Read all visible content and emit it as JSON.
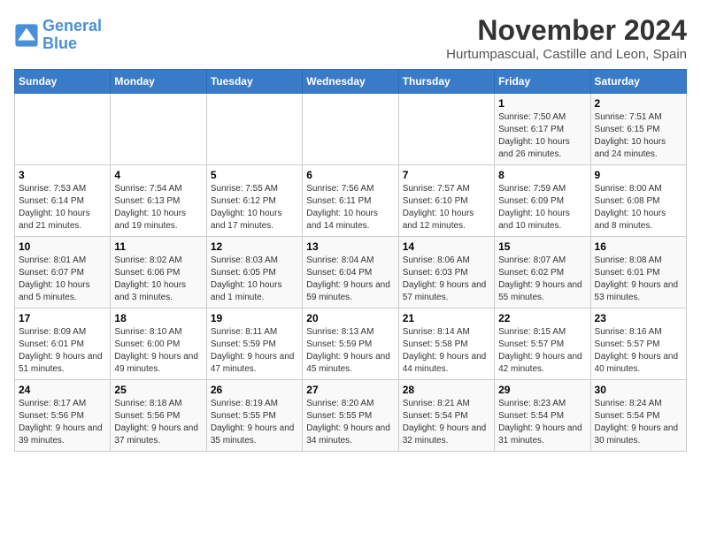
{
  "logo": {
    "line1": "General",
    "line2": "Blue"
  },
  "title": "November 2024",
  "location": "Hurtumpascual, Castille and Leon, Spain",
  "days_header": [
    "Sunday",
    "Monday",
    "Tuesday",
    "Wednesday",
    "Thursday",
    "Friday",
    "Saturday"
  ],
  "weeks": [
    [
      {
        "day": "",
        "info": ""
      },
      {
        "day": "",
        "info": ""
      },
      {
        "day": "",
        "info": ""
      },
      {
        "day": "",
        "info": ""
      },
      {
        "day": "",
        "info": ""
      },
      {
        "day": "1",
        "info": "Sunrise: 7:50 AM\nSunset: 6:17 PM\nDaylight: 10 hours and 26 minutes."
      },
      {
        "day": "2",
        "info": "Sunrise: 7:51 AM\nSunset: 6:15 PM\nDaylight: 10 hours and 24 minutes."
      }
    ],
    [
      {
        "day": "3",
        "info": "Sunrise: 7:53 AM\nSunset: 6:14 PM\nDaylight: 10 hours and 21 minutes."
      },
      {
        "day": "4",
        "info": "Sunrise: 7:54 AM\nSunset: 6:13 PM\nDaylight: 10 hours and 19 minutes."
      },
      {
        "day": "5",
        "info": "Sunrise: 7:55 AM\nSunset: 6:12 PM\nDaylight: 10 hours and 17 minutes."
      },
      {
        "day": "6",
        "info": "Sunrise: 7:56 AM\nSunset: 6:11 PM\nDaylight: 10 hours and 14 minutes."
      },
      {
        "day": "7",
        "info": "Sunrise: 7:57 AM\nSunset: 6:10 PM\nDaylight: 10 hours and 12 minutes."
      },
      {
        "day": "8",
        "info": "Sunrise: 7:59 AM\nSunset: 6:09 PM\nDaylight: 10 hours and 10 minutes."
      },
      {
        "day": "9",
        "info": "Sunrise: 8:00 AM\nSunset: 6:08 PM\nDaylight: 10 hours and 8 minutes."
      }
    ],
    [
      {
        "day": "10",
        "info": "Sunrise: 8:01 AM\nSunset: 6:07 PM\nDaylight: 10 hours and 5 minutes."
      },
      {
        "day": "11",
        "info": "Sunrise: 8:02 AM\nSunset: 6:06 PM\nDaylight: 10 hours and 3 minutes."
      },
      {
        "day": "12",
        "info": "Sunrise: 8:03 AM\nSunset: 6:05 PM\nDaylight: 10 hours and 1 minute."
      },
      {
        "day": "13",
        "info": "Sunrise: 8:04 AM\nSunset: 6:04 PM\nDaylight: 9 hours and 59 minutes."
      },
      {
        "day": "14",
        "info": "Sunrise: 8:06 AM\nSunset: 6:03 PM\nDaylight: 9 hours and 57 minutes."
      },
      {
        "day": "15",
        "info": "Sunrise: 8:07 AM\nSunset: 6:02 PM\nDaylight: 9 hours and 55 minutes."
      },
      {
        "day": "16",
        "info": "Sunrise: 8:08 AM\nSunset: 6:01 PM\nDaylight: 9 hours and 53 minutes."
      }
    ],
    [
      {
        "day": "17",
        "info": "Sunrise: 8:09 AM\nSunset: 6:01 PM\nDaylight: 9 hours and 51 minutes."
      },
      {
        "day": "18",
        "info": "Sunrise: 8:10 AM\nSunset: 6:00 PM\nDaylight: 9 hours and 49 minutes."
      },
      {
        "day": "19",
        "info": "Sunrise: 8:11 AM\nSunset: 5:59 PM\nDaylight: 9 hours and 47 minutes."
      },
      {
        "day": "20",
        "info": "Sunrise: 8:13 AM\nSunset: 5:59 PM\nDaylight: 9 hours and 45 minutes."
      },
      {
        "day": "21",
        "info": "Sunrise: 8:14 AM\nSunset: 5:58 PM\nDaylight: 9 hours and 44 minutes."
      },
      {
        "day": "22",
        "info": "Sunrise: 8:15 AM\nSunset: 5:57 PM\nDaylight: 9 hours and 42 minutes."
      },
      {
        "day": "23",
        "info": "Sunrise: 8:16 AM\nSunset: 5:57 PM\nDaylight: 9 hours and 40 minutes."
      }
    ],
    [
      {
        "day": "24",
        "info": "Sunrise: 8:17 AM\nSunset: 5:56 PM\nDaylight: 9 hours and 39 minutes."
      },
      {
        "day": "25",
        "info": "Sunrise: 8:18 AM\nSunset: 5:56 PM\nDaylight: 9 hours and 37 minutes."
      },
      {
        "day": "26",
        "info": "Sunrise: 8:19 AM\nSunset: 5:55 PM\nDaylight: 9 hours and 35 minutes."
      },
      {
        "day": "27",
        "info": "Sunrise: 8:20 AM\nSunset: 5:55 PM\nDaylight: 9 hours and 34 minutes."
      },
      {
        "day": "28",
        "info": "Sunrise: 8:21 AM\nSunset: 5:54 PM\nDaylight: 9 hours and 32 minutes."
      },
      {
        "day": "29",
        "info": "Sunrise: 8:23 AM\nSunset: 5:54 PM\nDaylight: 9 hours and 31 minutes."
      },
      {
        "day": "30",
        "info": "Sunrise: 8:24 AM\nSunset: 5:54 PM\nDaylight: 9 hours and 30 minutes."
      }
    ]
  ]
}
